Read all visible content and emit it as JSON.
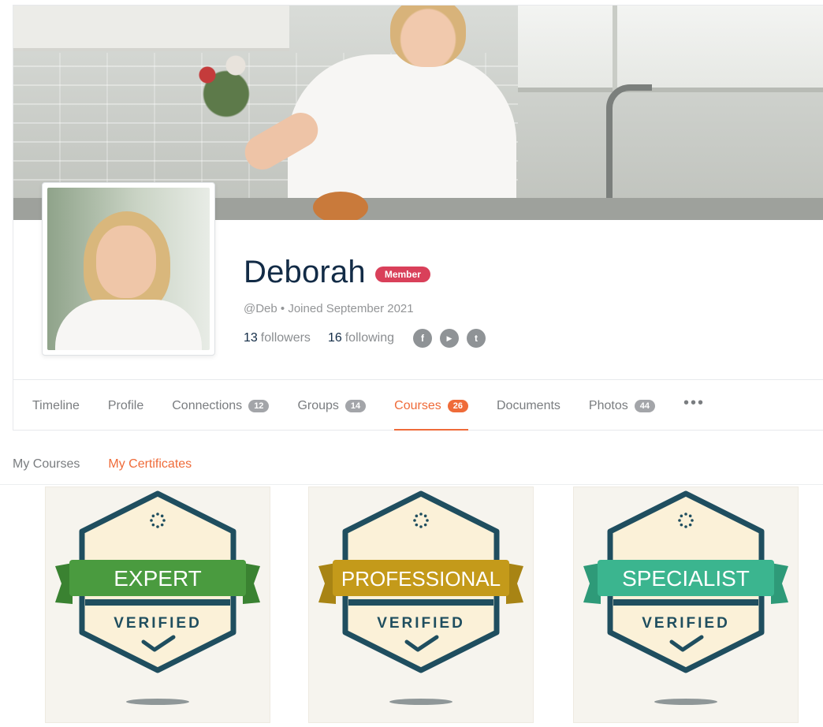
{
  "profile": {
    "name": "Deborah",
    "role_badge": "Member",
    "handle": "@Deb • Joined September 2021",
    "followers_count": "13",
    "followers_label": "followers",
    "following_count": "16",
    "following_label": "following",
    "socials": [
      {
        "icon": "facebook-icon",
        "glyph": "f"
      },
      {
        "icon": "youtube-icon",
        "glyph": "▶"
      },
      {
        "icon": "twitter-icon",
        "glyph": "t"
      }
    ]
  },
  "tabs": [
    {
      "label": "Timeline",
      "count": null
    },
    {
      "label": "Profile",
      "count": null
    },
    {
      "label": "Connections",
      "count": "12"
    },
    {
      "label": "Groups",
      "count": "14"
    },
    {
      "label": "Courses",
      "count": "26",
      "active": true
    },
    {
      "label": "Documents",
      "count": null
    },
    {
      "label": "Photos",
      "count": "44"
    }
  ],
  "more_label": "•••",
  "subtabs": {
    "my_courses": "My Courses",
    "my_certificates": "My Certificates"
  },
  "certificates": [
    {
      "title": "EXPERT",
      "subtitle": "VERIFIED",
      "ribbon_color": "#4a9b3f",
      "ribbon_dark": "#3a8231"
    },
    {
      "title": "PROFESSIONAL",
      "subtitle": "VERIFIED",
      "ribbon_color": "#c49a1a",
      "ribbon_dark": "#a88414"
    },
    {
      "title": "SPECIALIST",
      "subtitle": "VERIFIED",
      "ribbon_color": "#3bb58f",
      "ribbon_dark": "#2e9a78"
    }
  ],
  "colors": {
    "accent": "#ef6b39",
    "member_badge": "#d9405a",
    "badge_outline": "#1f4e5f"
  }
}
